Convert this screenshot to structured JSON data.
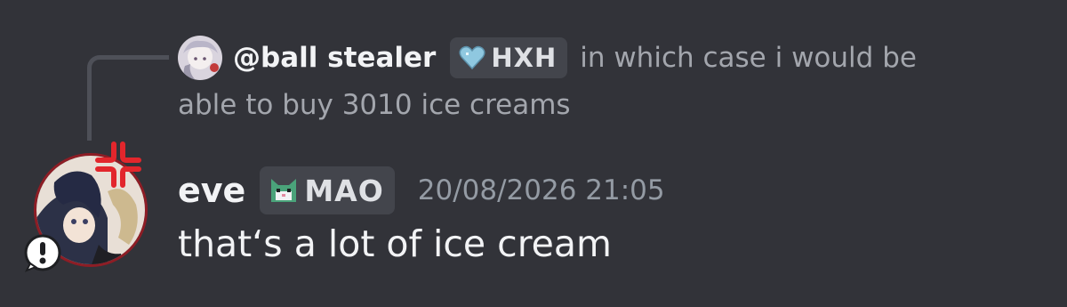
{
  "reply": {
    "author": "@ball stealer",
    "tag": "HXH",
    "text_line1": "in which case i would be",
    "text_line2": "able to buy 3010 ice creams",
    "tag_icon": "heart-icon"
  },
  "message": {
    "author": "eve",
    "tag": "MAO",
    "tag_icon": "cat-icon",
    "timestamp": "20/08/2026 21:05",
    "content": "that‘s a lot of ice cream",
    "avatar_decorations": [
      "anger-icon",
      "alert-icon"
    ]
  },
  "colors": {
    "background": "#323339",
    "text": "#f2f3f5",
    "muted": "#a3a6ad",
    "timestamp": "#949ba4",
    "tag_bg": "#43454c",
    "heart": "#8fc8e0",
    "cat": "#4aa37a",
    "anger": "#e2262c"
  }
}
